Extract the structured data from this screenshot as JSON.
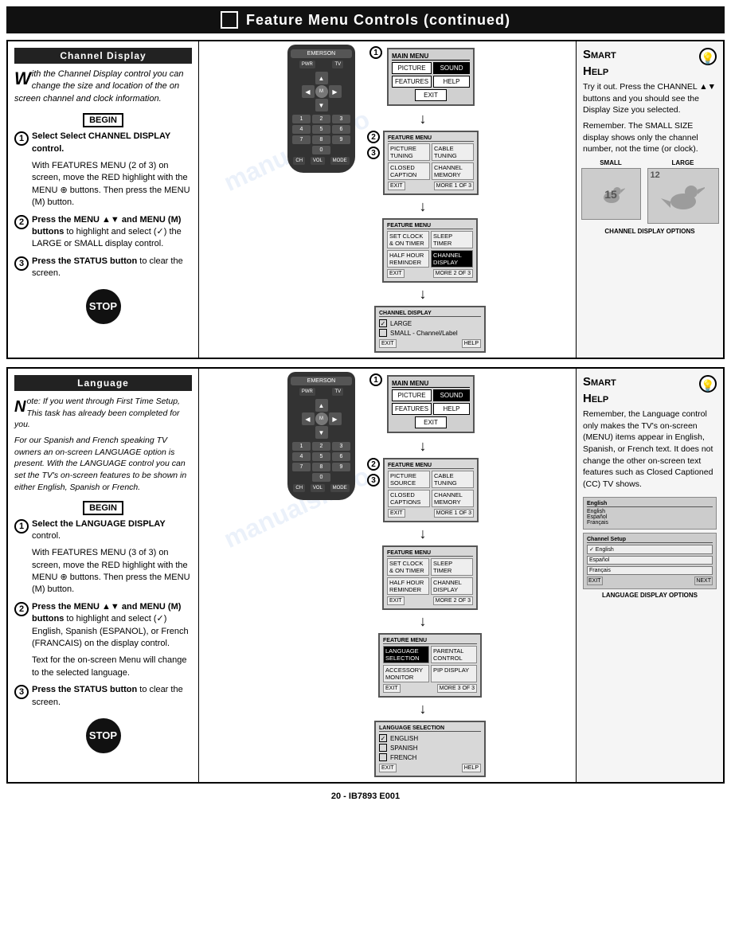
{
  "header": {
    "title": "Feature Menu Controls (continued)",
    "icon_label": "square-icon"
  },
  "channel_section": {
    "heading": "Channel Display",
    "intro": "With the Channel Display control you can change the size and location of the on screen channel and clock information.",
    "intro_dropcap": "W",
    "begin_label": "BEGIN",
    "step1_label": "Select CHANNEL DISPLAY control.",
    "step1_detail": "With FEATURES MENU (2 of 3) on screen, move the RED highlight with the MENU ⊕ buttons. Then press the MENU (M) button.",
    "step2_label": "Press the MENU ▲▼ and MENU (M) buttons to highlight and select (✓) the LARGE or SMALL display control.",
    "step3_label": "Press the STATUS button to clear the screen.",
    "stop_label": "STOP",
    "main_menu_label": "MAIN MENU",
    "main_menu_buttons": [
      "PICTURE",
      "SOUND",
      "FEATURES",
      "HELP",
      "EXIT"
    ],
    "feature_menu1_label": "FEATURE MENU",
    "feature_menu1_buttons": [
      "PICTURE TUNING",
      "CABLE TUNING",
      "CLOSED CAPTION",
      "CHANNEL MEMORY",
      "EXIT",
      "MORE 1 OF 3"
    ],
    "feature_menu2_label": "FEATURE MENU",
    "feature_menu2_buttons": [
      "SET CLOCK & ON TIMER",
      "SLEEP TIMER",
      "HALF HOUR REMINDER",
      "CHANNEL DISPLAY",
      "EXIT",
      "MORE 2 OF 3"
    ],
    "channel_options_label": "CHANNEL DISPLAY",
    "channel_opt_large": "LARGE",
    "channel_opt_small": "SMALL - Channel/Label",
    "channel_exit": "EXIT",
    "channel_help": "HELP",
    "channel_display_caption": "CHANNEL DISPLAY OPTIONS"
  },
  "channel_smart_help": {
    "heading_small": "Smart",
    "heading_large": "Help",
    "icon": "💡",
    "para1": "Try it out. Press the CHANNEL ▲▼ buttons and you should see the Display Size you selected.",
    "para2": "Remember. The SMALL SIZE display shows only the channel number, not the time (or clock).",
    "bird_small_label": "SMALL",
    "bird_large_label": "LARGE",
    "bird_small_num": "15",
    "bird_large_num": "12"
  },
  "language_section": {
    "heading": "Language",
    "intro1": "Note: If you went through First Time Setup, This task has already been completed for you.",
    "intro2": "For our Spanish and French speaking TV owners an on-screen LANGUAGE option is present. With the LANGUAGE control you can set the TV's on-screen features to be shown in either English, Spanish or French.",
    "begin_label": "BEGIN",
    "step1_label": "Select the LANGUAGE DISPLAY control.",
    "step1_detail": "With FEATURES MENU (3 of 3) on screen, move the RED highlight with the MENU ⊕ buttons. Then press the MENU (M) button.",
    "step2_label": "Press the MENU ▲▼ and MENU (M) buttons to highlight and select (✓) English, Spanish (ESPANOL), or French (FRANCAIS) on the display control.",
    "step3_label": "Press the STATUS button to clear the screen.",
    "note3": "Text for the on-screen Menu will change to the selected language.",
    "stop_label": "STOP",
    "feature_menu3_label": "FEATURE MENU",
    "feature_menu3_buttons": [
      "LANGUAGE SELECTION",
      "PARENTAL CONTROL",
      "ACCESSORY MONITOR",
      "PIP DISPLAY",
      "EXIT",
      "MORE 3 OF 3"
    ],
    "lang_options_label": "LANGUAGE SELECTION",
    "lang_opt_english": "ENGLISH",
    "lang_opt_spanish": "SPANISH",
    "lang_opt_french": "FRENCH",
    "lang_exit": "EXIT",
    "lang_help": "HELP",
    "language_display_caption": "LANGUAGE DISPLAY OPTIONS"
  },
  "language_smart_help": {
    "heading_small": "Smart",
    "heading_large": "Help",
    "icon": "💡",
    "para1": "Remember, the Language control only makes the TV's on-screen (MENU) items appear in English, Spanish, or French text. It does not change the other on-screen text features such as Closed Captioned (CC) TV shows."
  },
  "footer": {
    "text": "20 - IB7893 E001"
  }
}
